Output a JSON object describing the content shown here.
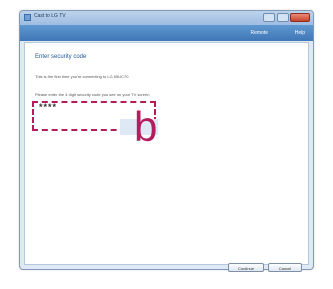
{
  "window": {
    "title": "Cast to LG TV",
    "toolbar_items": [
      "Remote",
      "Help"
    ]
  },
  "content": {
    "heading": "Enter security code",
    "line1": "This is the first time you're connecting to LG 55UC70",
    "line2": "Please enter the 4 digit security code you see on your TV screen",
    "code_mask": "****"
  },
  "annotation": {
    "label": "b",
    "color": "#b31c5d"
  },
  "buttons": {
    "continue": "Continue",
    "cancel": "Cancel"
  }
}
